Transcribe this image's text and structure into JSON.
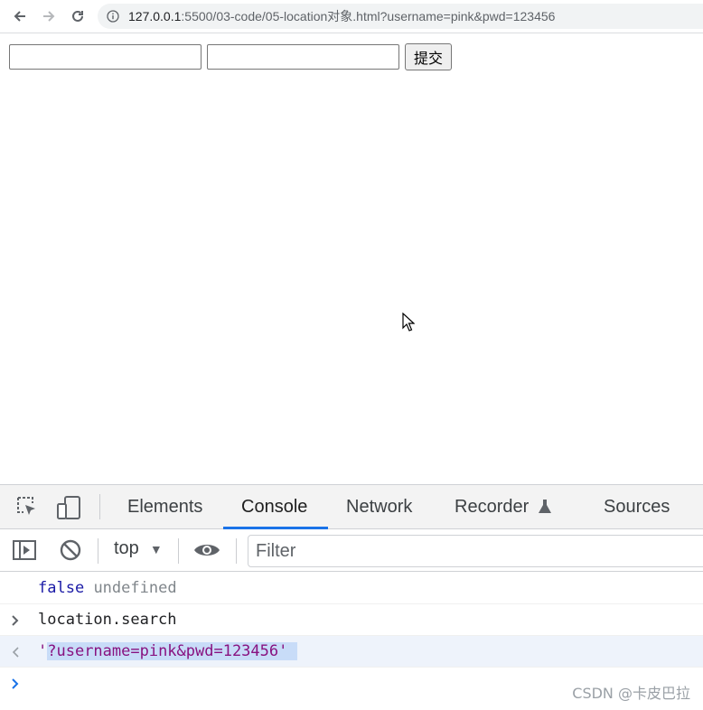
{
  "browser": {
    "url_host": "127.0.0.1",
    "url_rest": ":5500/03-code/05-location对象.html?username=pink&pwd=123456",
    "icons": [
      "back-arrow-icon",
      "forward-arrow-icon",
      "reload-icon",
      "info-icon"
    ]
  },
  "page": {
    "username_value": "",
    "password_value": "",
    "submit_label": "提交"
  },
  "devtools": {
    "tabs": [
      {
        "label": "Elements",
        "active": false
      },
      {
        "label": "Console",
        "active": true
      },
      {
        "label": "Network",
        "active": false
      },
      {
        "label": "Recorder",
        "active": false
      },
      {
        "label": "Sources",
        "active": false
      }
    ],
    "context": "top",
    "filter_placeholder": "Filter",
    "console": {
      "line1_kw": "false",
      "line1_rest": "undefined",
      "input_command": "location.search",
      "result_open_quote": "'",
      "result_value": "?username=pink&pwd=123456",
      "result_close_quote": "'"
    },
    "accent_color": "#1a73e8"
  },
  "watermark": "CSDN @卡皮巴拉"
}
